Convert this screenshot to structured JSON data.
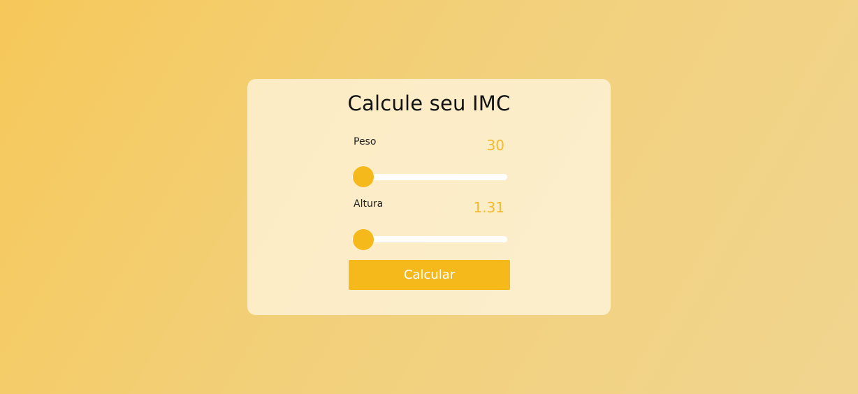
{
  "card": {
    "title": "Calcule seu IMC"
  },
  "peso": {
    "label": "Peso",
    "value": "30",
    "slider_fraction": 0.0
  },
  "altura": {
    "label": "Altura",
    "value": "1.31",
    "slider_fraction": 0.0
  },
  "button": {
    "label": "Calcular"
  },
  "colors": {
    "accent": "#f6b91c",
    "value_text": "#f6b92c",
    "track": "#ffffff"
  }
}
